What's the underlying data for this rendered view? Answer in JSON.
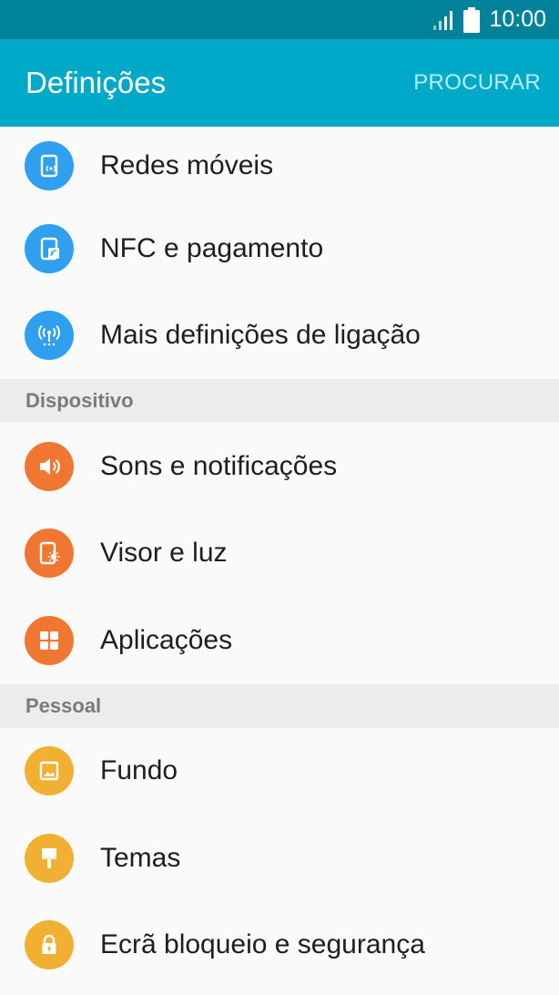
{
  "status_bar": {
    "time": "10:00"
  },
  "app_bar": {
    "title": "Definições",
    "search_label": "PROCURAR"
  },
  "colors": {
    "status_bar": "#00829b",
    "app_bar": "#00a9c8",
    "connections_icon": "#2f9ff0",
    "device_icon": "#ef7732",
    "personal_icon": "#f2b032"
  },
  "connections": {
    "items": [
      {
        "label": "Redes móveis",
        "icon": "mobile-network-icon"
      },
      {
        "label": "NFC e pagamento",
        "icon": "nfc-icon"
      },
      {
        "label": "Mais definições de ligação",
        "icon": "antenna-icon"
      }
    ]
  },
  "device": {
    "header": "Dispositivo",
    "items": [
      {
        "label": "Sons e notificações",
        "icon": "speaker-icon"
      },
      {
        "label": "Visor e luz",
        "icon": "display-icon"
      },
      {
        "label": "Aplicações",
        "icon": "apps-grid-icon"
      }
    ]
  },
  "personal": {
    "header": "Pessoal",
    "items": [
      {
        "label": "Fundo",
        "icon": "wallpaper-icon"
      },
      {
        "label": "Temas",
        "icon": "paintbrush-icon"
      },
      {
        "label": "Ecrã bloqueio e segurança",
        "icon": "lock-icon"
      }
    ]
  }
}
